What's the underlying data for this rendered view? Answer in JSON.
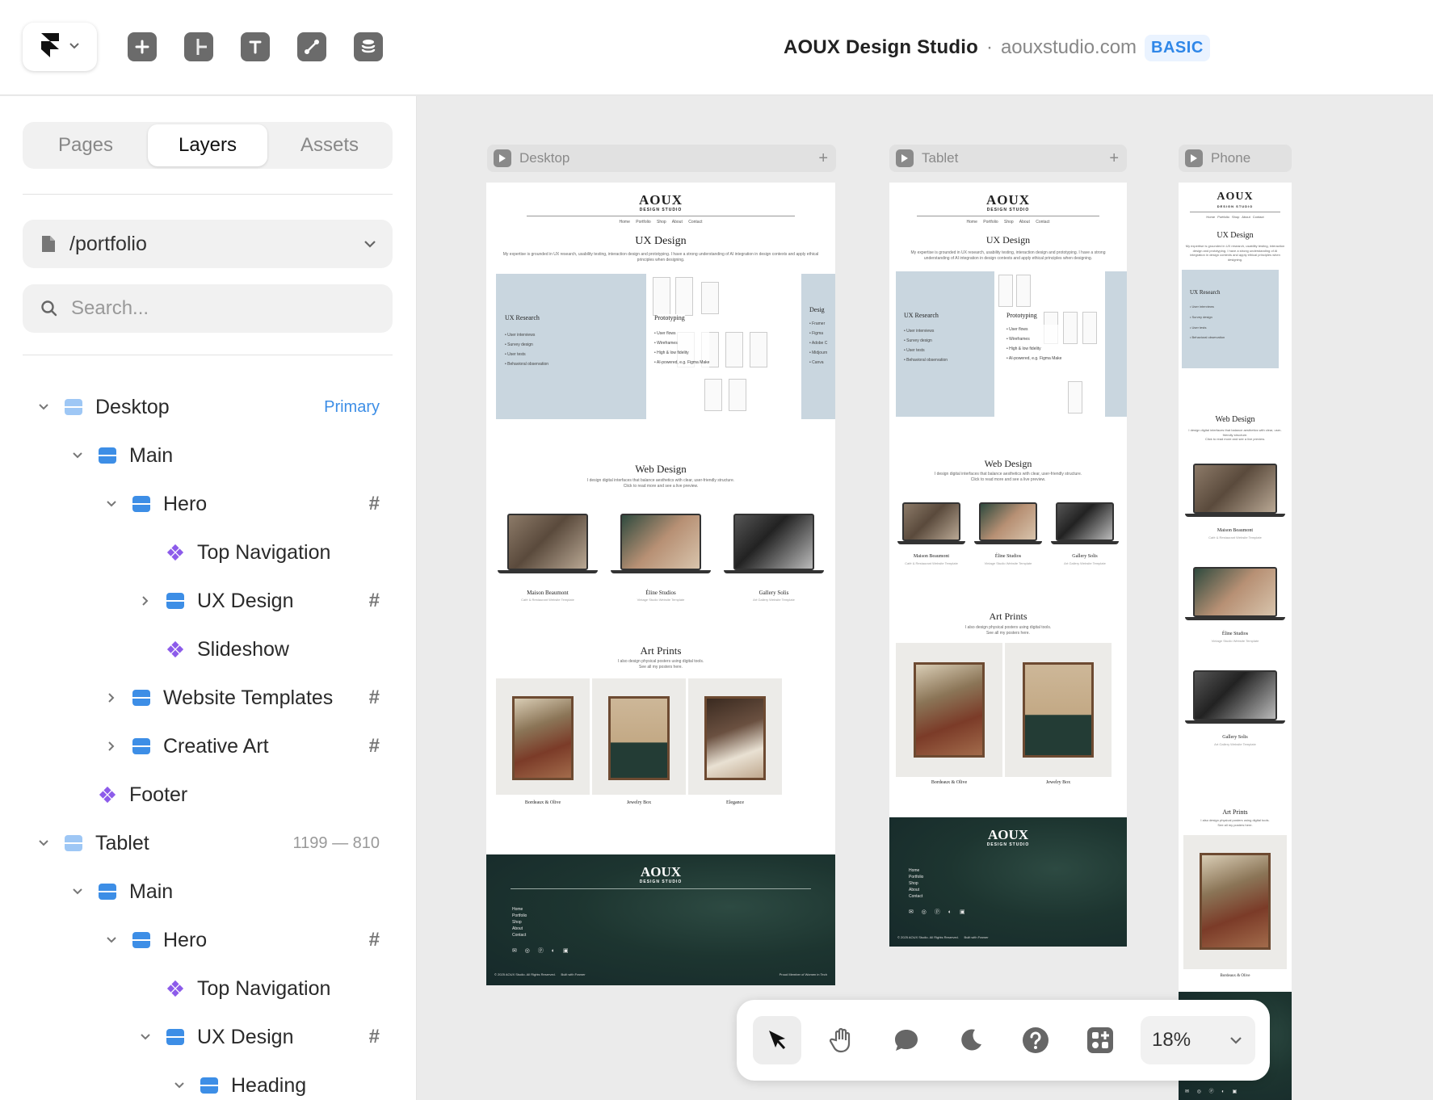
{
  "project": {
    "name": "AOUX Design Studio",
    "separator": "·",
    "domain": "aouxstudio.com",
    "plan": "BASIC"
  },
  "toolbar_icons": [
    "framer-logo-icon",
    "chevron-down-icon",
    "plus-icon",
    "layout-icon",
    "text-icon",
    "vector-pen-icon",
    "cms-database-icon"
  ],
  "sidebar": {
    "tabs": [
      {
        "label": "Pages",
        "active": false
      },
      {
        "label": "Layers",
        "active": true
      },
      {
        "label": "Assets",
        "active": false
      }
    ],
    "page_path": "/portfolio",
    "search_placeholder": "Search...",
    "layers": [
      {
        "label": "Desktop",
        "type": "breakpoint",
        "depth": 0,
        "expanded": true,
        "right": "Primary"
      },
      {
        "label": "Main",
        "type": "stack",
        "depth": 1,
        "expanded": true
      },
      {
        "label": "Hero",
        "type": "stack",
        "depth": 2,
        "expanded": true,
        "grid": true
      },
      {
        "label": "Top Navigation",
        "type": "component",
        "depth": 3
      },
      {
        "label": "UX Design",
        "type": "stack",
        "depth": 3,
        "expanded": false,
        "grid": true
      },
      {
        "label": "Slideshow",
        "type": "component",
        "depth": 3
      },
      {
        "label": "Website Templates",
        "type": "stack",
        "depth": 2,
        "expanded": false,
        "grid": true
      },
      {
        "label": "Creative Art",
        "type": "stack",
        "depth": 2,
        "expanded": false,
        "grid": true
      },
      {
        "label": "Footer",
        "type": "component",
        "depth": 1
      },
      {
        "label": "Tablet",
        "type": "breakpoint",
        "depth": 0,
        "expanded": true,
        "right": "1199 — 810"
      },
      {
        "label": "Main",
        "type": "stack",
        "depth": 1,
        "expanded": true
      },
      {
        "label": "Hero",
        "type": "stack",
        "depth": 2,
        "expanded": true,
        "grid": true
      },
      {
        "label": "Top Navigation",
        "type": "component",
        "depth": 3
      },
      {
        "label": "UX Design",
        "type": "stack",
        "depth": 3,
        "expanded": true,
        "grid": true
      },
      {
        "label": "Heading",
        "type": "stack",
        "depth": 4,
        "expanded": true
      }
    ],
    "grid_symbol": "#"
  },
  "canvas": {
    "breakpoints": [
      {
        "label": "Desktop",
        "plus": "+"
      },
      {
        "label": "Tablet",
        "plus": "+"
      },
      {
        "label": "Phone"
      }
    ],
    "site": {
      "logo": "AOUX",
      "logo_sub": "DESIGN STUDIO",
      "nav": "Home Portfolio Shop About Contact",
      "ux_title": "UX Design",
      "ux_text": "My expertise is grounded in UX research, usability testing, interaction design and prototyping. I have a strong understanding of AI integration in design contexts and apply ethical principles when designing.",
      "ux_research": "UX Research",
      "ux_research_items": "• User interviews\n• Survey design\n• User tests\n• Behavioral observation",
      "prototyping": "Prototyping",
      "prototyping_items": "• User flows\n• Wireframes\n• High & low fidelity\n• AI-powered, e.g. Figma Make",
      "design_partial": "Desig",
      "design_partial_items": "• Framer\n• Figma\n• Adobe C\n• Midjourn\n• Canva",
      "web_title": "Web Design",
      "web_text": "I design digital interfaces that balance aesthetics with clear, user-friendly structure.\nClick to read more and see a live preview.",
      "templates": [
        {
          "name": "Maison Beaumont",
          "sub": "Café & Restaurant Website Template"
        },
        {
          "name": "Éline Studios",
          "sub": "Vintage Studio Website Template"
        },
        {
          "name": "Gallery Solis",
          "sub": "Art Gallery Website Template"
        }
      ],
      "art_title": "Art Prints",
      "art_text": "I also design physical posters using digital tools.\nSee all my posters here.",
      "prints": [
        "Bordeaux & Olive",
        "Jewelry Box",
        "Elegance"
      ],
      "footer_links": "Home\nPortfolio\nShop\nAbout\nContact",
      "footer_icons": "✉ ◎ ⓟ ◐ ▣",
      "footer_copy": "© 2025 AOUX Studio. All Rights Reserved.      Built with Framer",
      "footer_right": "Proud Member of Women in Tech"
    }
  },
  "bottom_toolbar": {
    "tools": [
      "select-cursor-icon",
      "hand-pan-icon",
      "comment-icon",
      "dark-mode-moon-icon",
      "help-icon",
      "plugins-icon"
    ],
    "zoom": "18%"
  }
}
